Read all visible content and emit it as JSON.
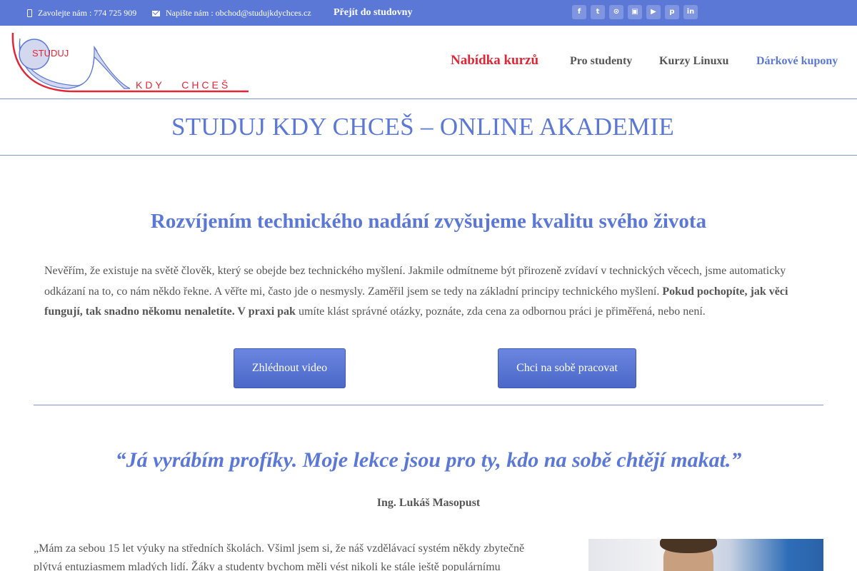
{
  "topbar": {
    "phone_text": "Zavolejte nám : 774 725 909",
    "email_text": "Napište nám : obchod@studujkdychces.cz",
    "studovna_link": "Přejít do studovny",
    "socials": [
      {
        "name": "facebook-icon",
        "glyph": "f"
      },
      {
        "name": "twitter-icon",
        "glyph": "t"
      },
      {
        "name": "rss-icon",
        "glyph": "⊙"
      },
      {
        "name": "instagram-icon",
        "glyph": "▣"
      },
      {
        "name": "youtube-icon",
        "glyph": "▶"
      },
      {
        "name": "pinterest-icon",
        "glyph": "p"
      },
      {
        "name": "linkedin-icon",
        "glyph": "in"
      }
    ]
  },
  "logo": {
    "line1": "STUDUJ",
    "line2": "KDY   CHCEŠ",
    "brand_red": "#e32636",
    "brand_blue": "#5b78d6"
  },
  "nav": {
    "items": [
      {
        "label": "Nabídka kurzů",
        "color": "#e32636"
      },
      {
        "label": "Pro studenty",
        "color": "#555555"
      },
      {
        "label": "Kurzy Linuxu",
        "color": "#555555"
      },
      {
        "label": "Dárkové kupony",
        "color": "#5b78d6"
      }
    ]
  },
  "page_title": "STUDUJ KDY CHCEŠ – ONLINE AKADEMIE",
  "headline": "Rozvíjením technického nadání zvyšujeme kvalitu svého života",
  "intro": {
    "part1": "Nevěřím, že existuje na světě člověk, který se obejde bez technického myšlení. Jakmile odmítneme být přirozeně zvídaví v technických věcech, jsme automaticky odkázaní na to, co nám někdo řekne. A věřte mi, často jde o nesmysly. Zaměřil jsem se tedy na základní principy technického myšlení.",
    "bold": "Pokud pochopíte, jak věci fungují, tak snadno někomu nenaletíte. V praxi pak",
    "part2": "umíte klást správné otázky, poznáte, zda cena za odbornou práci je přiměřená, nebo není."
  },
  "buttons": {
    "video": "Zhlédnout video",
    "work": "Chci na sobě pracovat"
  },
  "quote": "“Já vyrábím profíky. Moje lekce jsou pro ty, kdo na sobě chtějí makat.”",
  "author": "Ing. Lukáš Masopust",
  "bio": "„Mám za sebou 15 let výuky na středních školách. Všiml jsem si, že náš vzdělávací systém někdy zbytečně plýtvá entuziasmem mladých lidí. Žáky a studenty bychom měli vést nikoli ke stále ještě populárnímu"
}
